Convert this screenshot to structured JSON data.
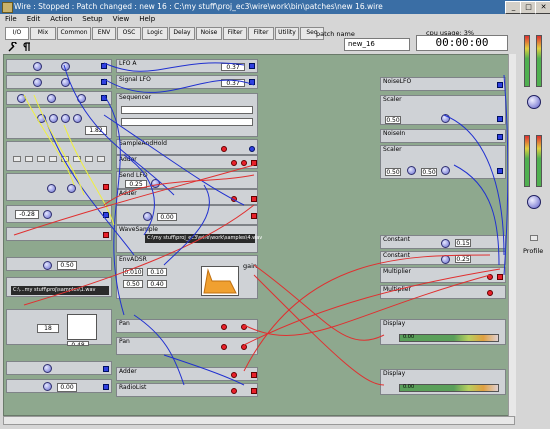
{
  "window": {
    "title": "Wire : Stopped : Patch changed : new 16 : C:\\my stuff\\proj_ec3\\wire\\work\\bin\\patches\\new 16.wire",
    "min": "_",
    "max": "□",
    "close": "✕"
  },
  "menu": [
    "File",
    "Edit",
    "Action",
    "Setup",
    "View",
    "Help"
  ],
  "tabs": [
    "I/O",
    "Mix",
    "Common",
    "ENV",
    "OSC",
    "Logic",
    "Delay",
    "Noise",
    "Filter",
    "Filter",
    "Utility",
    "Seq"
  ],
  "patch_name_label": "patch name",
  "patch_name_value": "new_16",
  "cpu_label": "cpu usage: 3%",
  "clock": "00:00:00",
  "modules": {
    "lfo_a": "LFO A",
    "signal_lfo": "Signal LFO",
    "sequencer": "Sequencer",
    "sample_hold": "SampleAndHold",
    "adder1": "Adder",
    "send_lfo": "Send LFO",
    "adder2": "Adder",
    "wave_sample": "WaveSample",
    "env_adsr": "EnvADSR",
    "pan": "Pan",
    "pan2": "Pan",
    "adder3": "Adder",
    "radio_list": "RadioList",
    "noise_lfo": "NoiseLFO",
    "scaler1": "Scaler",
    "noise_in": "NoiseIn",
    "scaler2": "Scaler",
    "constant1": "Constant",
    "constant2": "Constant",
    "multiplier1": "Multiplier",
    "multiplier2": "Multiplier",
    "display1": "Display",
    "display2": "Display",
    "gain": "gain"
  },
  "values": {
    "lfo_rate": "0.37",
    "seq_a": "1.82",
    "sh_val": "0.40",
    "send_val": "0.25",
    "v1": "-0.28",
    "v2": "0.50",
    "v3": "0.00",
    "v4": "0.00",
    "attack": "0.010",
    "decay": "0.10",
    "sustain": "0.50",
    "release": "0.40",
    "s1": "100",
    "s2": "0.00",
    "nl1": "0.50",
    "nl2": "0.50",
    "sc1": "0.50",
    "sc2": "0.50",
    "c1": "0.15",
    "c2": "0.25",
    "d1": "0.00",
    "d2": "0.00",
    "wav_path": "C:\\my stuff\\proj_ec3\\wire\\work\\samples\\4.wav",
    "path2": "C:\\...my stuff\\proj\\samples\\1.wav",
    "mul1": "18",
    "mul2": "0.48"
  },
  "right_panel": {
    "label": "Profile"
  },
  "colors": {
    "workspace": "#8ea88e",
    "cable_red": "#e03030",
    "cable_blue": "#2030d0",
    "cable_yellow": "#f0f040"
  }
}
